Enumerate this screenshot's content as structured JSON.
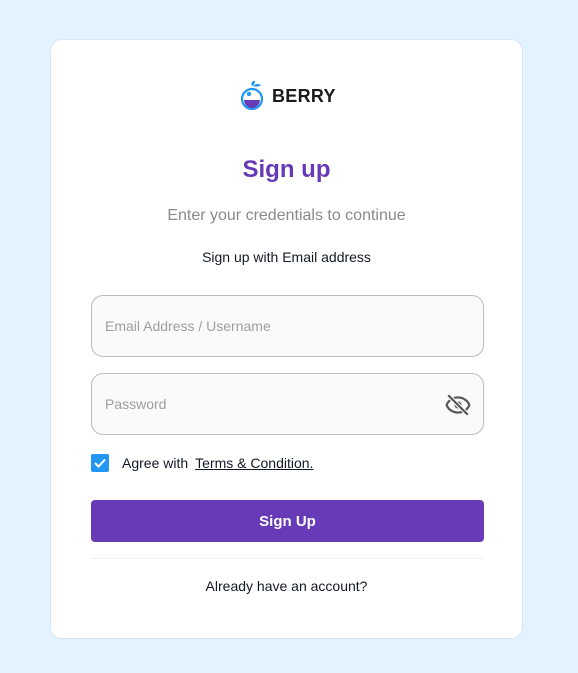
{
  "brand": {
    "name": "BERRY",
    "logo_icon": "berry-logo-icon"
  },
  "form": {
    "title": "Sign up",
    "subtitle": "Enter your credentials to continue",
    "method_label": "Sign up with Email address",
    "email_placeholder": "Email Address / Username",
    "email_value": "",
    "password_placeholder": "Password",
    "password_value": "",
    "password_toggle_icon": "eye-off-icon",
    "agree_checked": true,
    "agree_label": "Agree with",
    "terms_link": "Terms & Condition.",
    "submit_label": "Sign Up",
    "login_link": "Already have an account?"
  },
  "colors": {
    "background": "#e3f2fd",
    "primary": "#673ab7",
    "checkbox": "#2196f3",
    "brand_blue": "#2196f3"
  }
}
